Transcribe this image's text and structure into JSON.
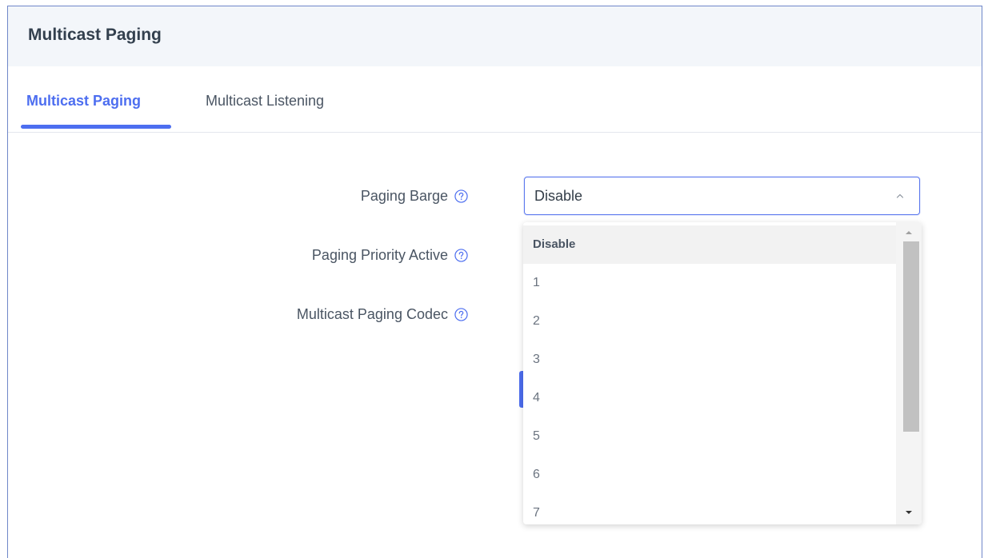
{
  "panel": {
    "title": "Multicast Paging"
  },
  "tabs": [
    {
      "label": "Multicast Paging",
      "active": true
    },
    {
      "label": "Multicast Listening",
      "active": false
    }
  ],
  "form": {
    "paging_barge": {
      "label": "Paging Barge",
      "value": "Disable"
    },
    "paging_priority_active": {
      "label": "Paging Priority Active"
    },
    "multicast_paging_codec": {
      "label": "Multicast Paging Codec"
    }
  },
  "dropdown": {
    "options": [
      "Disable",
      "1",
      "2",
      "3",
      "4",
      "5",
      "6",
      "7"
    ],
    "selected": "Disable"
  },
  "icons": {
    "help": "question-circle-icon",
    "chevron": "chevron-up-icon",
    "scroll_up": "triangle-up-icon",
    "scroll_down": "triangle-down-icon"
  },
  "colors": {
    "accent": "#4d6ef0",
    "header_bg": "#f3f6fa",
    "frame_border": "#6f87c9"
  }
}
